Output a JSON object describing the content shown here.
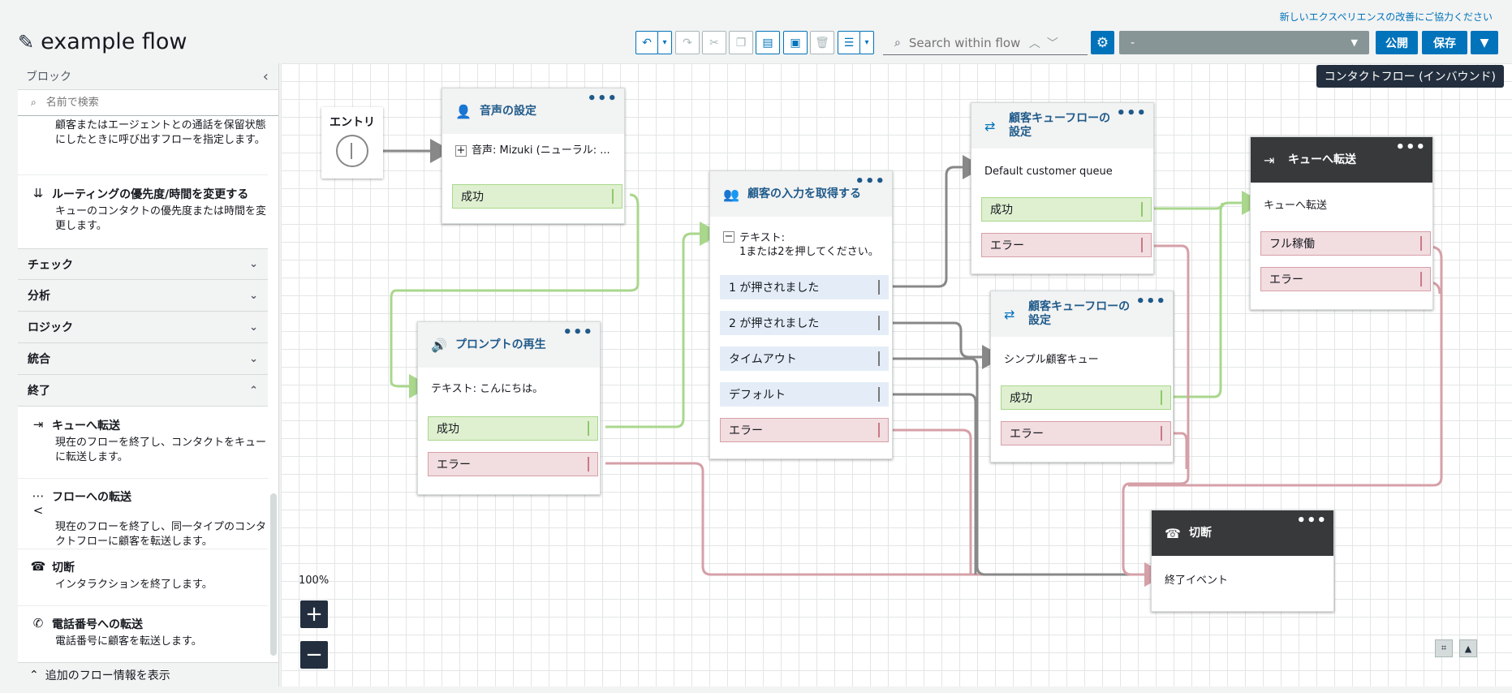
{
  "header": {
    "feedback_link": "新しいエクスペリエンスの改善にご協力ください",
    "flow_title": "example flow",
    "search_placeholder": "Search within flow",
    "version_value": "-",
    "publish_label": "公開",
    "save_label": "保存"
  },
  "sidebar": {
    "title": "ブロック",
    "search_placeholder": "名前で検索",
    "partial_block_desc": "顧客またはエージェントとの通話を保留状態にしたときに呼び出すフローを指定します。",
    "routing_block": {
      "name": "ルーティングの優先度/時間を変更する",
      "desc": "キューのコンタクトの優先度または時間を変更します。"
    },
    "categories": [
      "チェック",
      "分析",
      "ロジック",
      "統合",
      "終了"
    ],
    "end_blocks": [
      {
        "name": "キューへ転送",
        "desc": "現在のフローを終了し、コンタクトをキューに転送します。",
        "icon": "queue-transfer-icon"
      },
      {
        "name": "フローへの転送",
        "desc": "現在のフローを終了し、同一タイプのコンタクトフローに顧客を転送します。",
        "icon": "flow-transfer-icon"
      },
      {
        "name": "切断",
        "desc": "インタラクションを終了します。",
        "icon": "disconnect-icon"
      },
      {
        "name": "電話番号への転送",
        "desc": "電話番号に顧客を転送します。",
        "icon": "phone-transfer-icon"
      }
    ],
    "footer_link": "追加のフロー情報を表示"
  },
  "canvas": {
    "flow_type_badge": "コンタクトフロー (インバウンド)",
    "zoom_level": "100%",
    "entry": {
      "label": "エントリ"
    },
    "nodes": {
      "voice": {
        "title": "音声の設定",
        "body": "音声: Mizuki (ニューラル: ...",
        "success": "成功"
      },
      "prompt": {
        "title": "プロンプトの再生",
        "body": "テキスト: こんにちは。",
        "success": "成功",
        "error": "エラー"
      },
      "input": {
        "title": "顧客の入力を取得する",
        "body_line1": "テキスト:",
        "body_line2": "1または2を押してください。",
        "options": [
          "1 が押されました",
          "2 が押されました",
          "タイムアウト",
          "デフォルト"
        ],
        "error": "エラー"
      },
      "queue1": {
        "title": "顧客キューフローの設定",
        "body": "Default customer queue",
        "success": "成功",
        "error": "エラー"
      },
      "queue2": {
        "title": "顧客キューフローの設定",
        "body": "シンプル顧客キュー",
        "success": "成功",
        "error": "エラー"
      },
      "transfer": {
        "title": "キューへ転送",
        "body": "キューへ転送",
        "full": "フル稼働",
        "error": "エラー"
      },
      "disconnect": {
        "title": "切断",
        "body": "終了イベント"
      }
    }
  },
  "colors": {
    "accent": "#0073bb",
    "success": "#8dc96a",
    "error": "#c87a86",
    "wire": "#888888",
    "dark_node": "#37393b"
  }
}
